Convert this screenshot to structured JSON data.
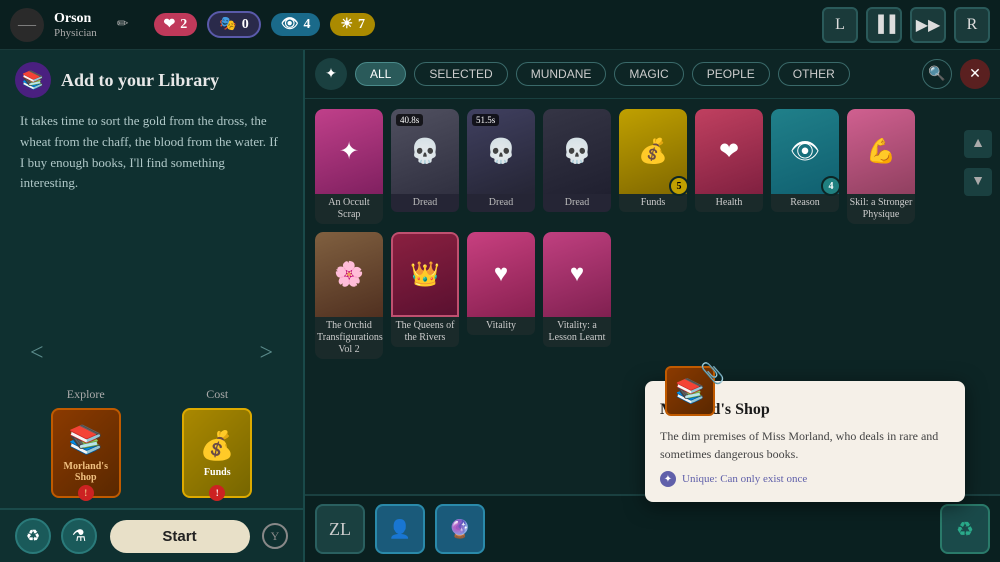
{
  "topBar": {
    "playerName": "Orson",
    "playerClass": "Physician",
    "stats": [
      {
        "id": "heart",
        "icon": "❤",
        "value": "2",
        "class": "stat-heart"
      },
      {
        "id": "mask",
        "icon": "🎭",
        "value": "0",
        "class": "stat-mask"
      },
      {
        "id": "eye",
        "icon": "👁",
        "value": "4",
        "class": "stat-eye"
      },
      {
        "id": "sun",
        "icon": "☀",
        "value": "7",
        "class": "stat-sun"
      }
    ],
    "rightButtons": [
      "L",
      "▐▐",
      "▶▶",
      "R"
    ]
  },
  "leftPanel": {
    "title": "Add to your Library",
    "iconSymbol": "📚",
    "bodyText": "It takes time to sort the gold from the dross, the wheat from the chaff, the blood from the water. If I buy enough books, I'll find something interesting.",
    "explore": {
      "label": "Explore",
      "cardName": "Morland's Shop",
      "cardIcon": "📚"
    },
    "cost": {
      "label": "Cost",
      "cardName": "Funds",
      "cardIcon": "💰"
    },
    "startLabel": "Start",
    "bottomIcons": [
      "♻",
      "⚗"
    ]
  },
  "filterBar": {
    "hubIcon": "✦",
    "filters": [
      {
        "id": "all",
        "label": "ALL",
        "active": true
      },
      {
        "id": "selected",
        "label": "SELECTED",
        "active": false
      },
      {
        "id": "mundane",
        "label": "MUNDANE",
        "active": false
      },
      {
        "id": "magic",
        "label": "MAGIC",
        "active": false
      },
      {
        "id": "people",
        "label": "PEOPLE",
        "active": false
      },
      {
        "id": "other",
        "label": "OTHER",
        "active": false
      }
    ]
  },
  "cards": [
    {
      "id": "occult-scrap",
      "name": "An Occult Scrap",
      "colorClass": "card-pink",
      "labelClass": "label-bg-dark",
      "icon": "✦",
      "timer": null,
      "badge": null
    },
    {
      "id": "dread-1",
      "name": "Dread",
      "colorClass": "card-gray",
      "labelClass": "label-bg-gray",
      "icon": "💀",
      "timer": "40.8s",
      "badge": null
    },
    {
      "id": "dread-2",
      "name": "Dread",
      "colorClass": "card-blue-gray",
      "labelClass": "label-bg-gray",
      "icon": "💀",
      "timer": "51.5s",
      "badge": null
    },
    {
      "id": "dread-3",
      "name": "Dread",
      "colorClass": "card-dark",
      "labelClass": "label-bg-gray",
      "icon": "💀",
      "timer": null,
      "badge": null
    },
    {
      "id": "funds",
      "name": "Funds",
      "colorClass": "card-yellow",
      "labelClass": "label-bg-dark",
      "icon": "💰",
      "timer": null,
      "badge": {
        "num": "5",
        "class": "badge-yellow-bg"
      }
    },
    {
      "id": "health",
      "name": "Health",
      "colorClass": "card-red-pink",
      "labelClass": "label-bg-dark",
      "icon": "❤",
      "timer": null,
      "badge": null
    },
    {
      "id": "reason",
      "name": "Reason",
      "colorClass": "card-teal",
      "labelClass": "label-bg-dark",
      "icon": "👁",
      "timer": null,
      "badge": {
        "num": "4",
        "class": "badge-teal-bg"
      }
    },
    {
      "id": "skil",
      "name": "Skil: a Stronger Physique",
      "colorClass": "card-pink-light",
      "labelClass": "label-bg-dark",
      "icon": "💪",
      "timer": null,
      "badge": null
    },
    {
      "id": "orchid",
      "name": "The Orchid Transfigurations, Vol 2",
      "colorClass": "card-brown",
      "labelClass": "label-bg-dark",
      "icon": "🌸",
      "timer": null,
      "badge": null
    },
    {
      "id": "queens-rivers",
      "name": "The Queens of the Rivers",
      "colorClass": "card-green-book",
      "labelClass": "label-bg-dark",
      "icon": "👑",
      "timer": null,
      "badge": null
    },
    {
      "id": "vitality",
      "name": "Vitality",
      "colorClass": "card-vitality-pink",
      "labelClass": "label-bg-dark",
      "icon": "♥",
      "timer": null,
      "badge": null
    },
    {
      "id": "vitality-lesson",
      "name": "Vitality: a Lesson Learnt",
      "colorClass": "card-vitality-lesson",
      "labelClass": "label-bg-dark",
      "icon": "♥",
      "timer": null,
      "badge": null
    }
  ],
  "tooltip": {
    "title": "Morland's Shop",
    "icon": "📚",
    "description": "The dim premises of Miss Morland, who deals in rare and sometimes dangerous books.",
    "uniqueText": "Unique: Can only exist once"
  },
  "bottomRight": {
    "btns": [
      "ZL",
      "👤",
      "🔮"
    ],
    "rightBtn": "♻"
  }
}
